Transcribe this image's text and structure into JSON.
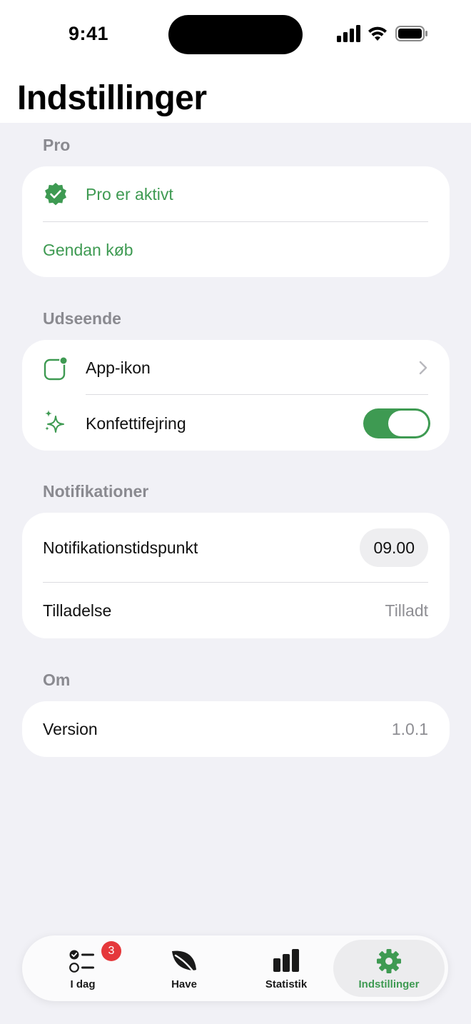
{
  "status_bar": {
    "time": "9:41"
  },
  "page": {
    "title": "Indstillinger"
  },
  "sections": {
    "pro": {
      "header": "Pro",
      "active_label": "Pro er aktivt",
      "restore_label": "Gendan køb"
    },
    "appearance": {
      "header": "Udseende",
      "app_icon_label": "App-ikon",
      "confetti_label": "Konfettifejring",
      "confetti_enabled": true
    },
    "notifications": {
      "header": "Notifikationer",
      "time_label": "Notifikationstidspunkt",
      "time_value": "09.00",
      "permission_label": "Tilladelse",
      "permission_value": "Tilladt"
    },
    "about": {
      "header": "Om",
      "version_label": "Version",
      "version_value": "1.0.1"
    }
  },
  "tabbar": {
    "today": {
      "label": "I dag",
      "badge": "3"
    },
    "garden": {
      "label": "Have"
    },
    "stats": {
      "label": "Statistik"
    },
    "settings": {
      "label": "Indstillinger",
      "active": true
    }
  },
  "colors": {
    "accent": "#3e9a52",
    "badge": "#e5383b",
    "background": "#f1f1f6",
    "secondary_text": "#8e8e93"
  },
  "icons": {
    "pro": "checkmark-seal-icon",
    "app_icon": "app-icon-square-icon",
    "confetti": "sparkles-icon",
    "chevron": "chevron-right-icon",
    "today": "checklist-icon",
    "garden": "leaf-icon",
    "stats": "bar-chart-icon",
    "settings": "gear-icon"
  }
}
